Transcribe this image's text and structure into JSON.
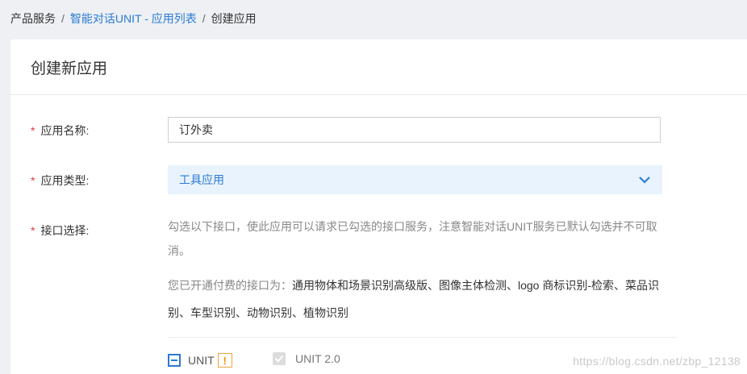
{
  "breadcrumb": {
    "item1": "产品服务",
    "item2": "智能对话UNIT - 应用列表",
    "item3": "创建应用",
    "separator": "/"
  },
  "card": {
    "title": "创建新应用"
  },
  "form": {
    "required_mark": "*",
    "app_name": {
      "label": "应用名称:",
      "value": "订外卖"
    },
    "app_type": {
      "label": "应用类型:",
      "value": "工具应用"
    },
    "api": {
      "label": "接口选择:",
      "description": "勾选以下接口，使此应用可以请求已勾选的接口服务，注意智能对话UNIT服务已默认勾选并不可取消。",
      "paid_prefix": "您已开通付费的接口为：",
      "paid_list": "通用物体和场景识别高级版、图像主体检测、logo 商标识别-检索、菜品识别、车型识别、动物识别、植物识别",
      "options": {
        "unit": "UNIT",
        "unit_warn": "!",
        "unit2": "UNIT 2.0"
      }
    }
  },
  "watermark": "https://blog.csdn.net/zbp_12138",
  "colors": {
    "link": "#2b7bd3",
    "required": "#e4393c",
    "select_bg": "#e8f3fd",
    "warn": "#f08c00"
  }
}
